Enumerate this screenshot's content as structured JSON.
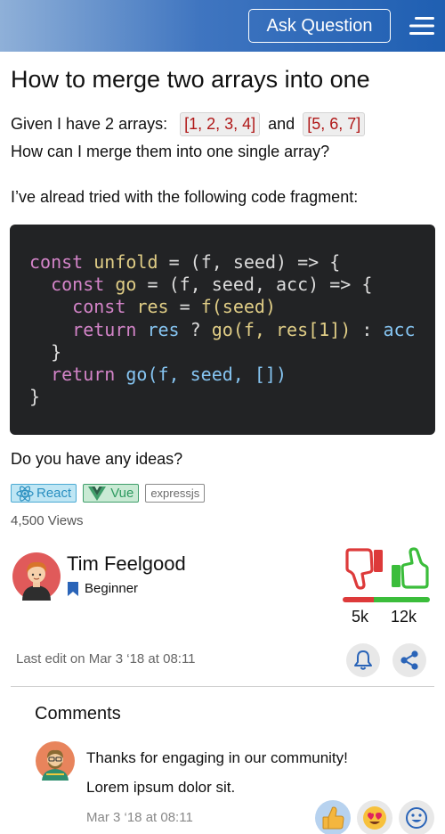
{
  "header": {
    "ask_button": "Ask Question",
    "menu_icon": "hamburger-menu-icon"
  },
  "question": {
    "title": "How to merge two arrays into one",
    "intro_prefix": "Given I have 2 arrays:",
    "array_one": "[1, 2, 3, 4]",
    "and": "and",
    "array_two": "[5, 6, 7]",
    "line2": "How can I merge them into one single array?",
    "line3": "I’ve alread tried with the following code fragment:",
    "closing": "Do you have any ideas?",
    "views": "4,500 Views",
    "tags": [
      {
        "label": "React",
        "icon": "react-icon"
      },
      {
        "label": "Vue",
        "icon": "vue-icon"
      },
      {
        "label": "expressjs"
      }
    ]
  },
  "code": {
    "tokens": {
      "const": "const",
      "unfold": "unfold",
      "eq": "=",
      "params1": "(f, seed)",
      "arrow": "=>",
      "brace_open": "{",
      "go": "go",
      "params2": "(f, seed, acc)",
      "res": "res",
      "f_seed": "f(seed)",
      "return": "return",
      "ternary": "?",
      "go_call": "go(f,",
      "res_one": "res[1])",
      "colon": ":",
      "acc": "acc",
      "brace_close": "}",
      "go_final": "go(f, seed, [])"
    }
  },
  "author": {
    "name": "Tim Feelgood",
    "rank": "Beginner",
    "downvotes": "5k",
    "upvotes": "12k",
    "last_edit": "Last edit on Mar 3 ‘18 at 08:11",
    "downvote_share": 0.36,
    "upvote_share": 0.64
  },
  "comments": {
    "title": "Comments",
    "items": [
      {
        "line1": "Thanks for engaging in our community!",
        "line2": "Lorem ipsum dolor sit.",
        "date": "Mar 3 ‘18 at 08:11"
      }
    ]
  },
  "colors": {
    "header_gradient_end": "#1f5fb2",
    "downvote": "#dd3a3a",
    "upvote": "#3bbd3b",
    "code_bg": "#222325"
  }
}
